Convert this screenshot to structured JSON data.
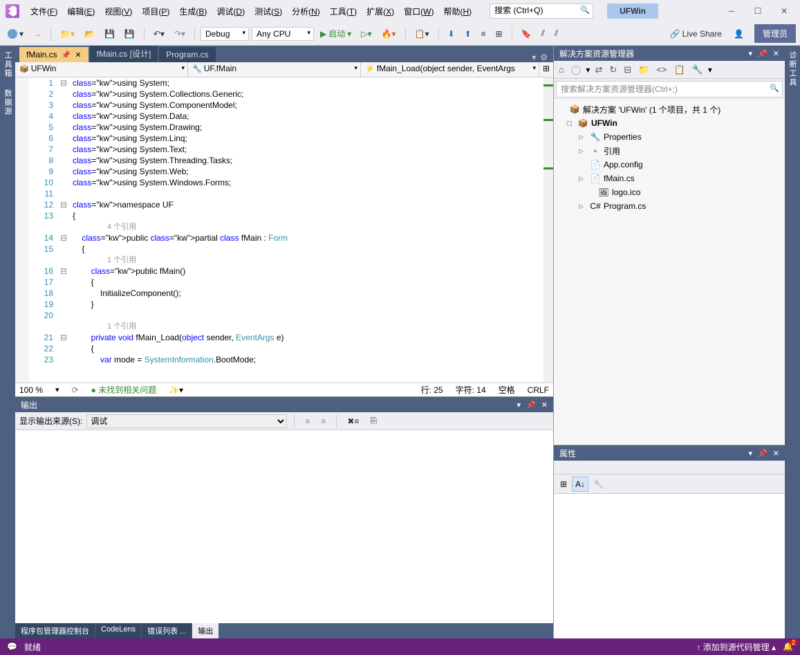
{
  "title_project": "UFWin",
  "search_placeholder": "搜索 (Ctrl+Q)",
  "admin_label": "管理员",
  "liveshare": "Live Share",
  "menu": [
    "文件(F)",
    "编辑(E)",
    "视图(V)",
    "项目(P)",
    "生成(B)",
    "调试(D)",
    "测试(S)",
    "分析(N)",
    "工具(T)",
    "扩展(X)",
    "窗口(W)",
    "帮助(H)"
  ],
  "toolbar_config": "Debug",
  "toolbar_platform": "Any CPU",
  "toolbar_run": "启动",
  "left_dock": [
    "工具箱",
    "数据源"
  ],
  "right_dock": "诊断工具",
  "editor_tabs": [
    {
      "label": "fMain.cs",
      "active": true
    },
    {
      "label": "fMain.cs [设计]",
      "active": false
    },
    {
      "label": "Program.cs",
      "active": false
    }
  ],
  "nav": {
    "scope": "UFWin",
    "class": "UF.fMain",
    "member": "fMain_Load(object sender, EventArgs"
  },
  "code_lines": [
    {
      "n": 1,
      "fold": "⊟",
      "t": "using System;"
    },
    {
      "n": 2,
      "t": "using System.Collections.Generic;"
    },
    {
      "n": 3,
      "t": "using System.ComponentModel;"
    },
    {
      "n": 4,
      "t": "using System.Data;"
    },
    {
      "n": 5,
      "t": "using System.Drawing;"
    },
    {
      "n": 6,
      "t": "using System.Linq;"
    },
    {
      "n": 7,
      "t": "using System.Text;"
    },
    {
      "n": 8,
      "t": "using System.Threading.Tasks;"
    },
    {
      "n": 9,
      "t": "using System.Web;"
    },
    {
      "n": 10,
      "t": "using System.Windows.Forms;"
    },
    {
      "n": 11,
      "t": ""
    },
    {
      "n": 12,
      "fold": "⊟",
      "t": "namespace UF"
    },
    {
      "n": 13,
      "t": "{"
    },
    {
      "ref": "4 个引用"
    },
    {
      "n": 14,
      "fold": "⊟",
      "t": "    public partial class fMain : Form"
    },
    {
      "n": 15,
      "t": "    {"
    },
    {
      "ref": "1 个引用"
    },
    {
      "n": 16,
      "fold": "⊟",
      "t": "        public fMain()"
    },
    {
      "n": 17,
      "t": "        {"
    },
    {
      "n": 18,
      "t": "            InitializeComponent();"
    },
    {
      "n": 19,
      "t": "        }"
    },
    {
      "n": 20,
      "t": ""
    },
    {
      "ref": "1 个引用"
    },
    {
      "n": 21,
      "fold": "⊟",
      "t": "        private void fMain_Load(object sender, EventArgs e)"
    },
    {
      "n": 22,
      "t": "        {"
    },
    {
      "n": 23,
      "t": "            var mode = SystemInformation.BootMode;"
    }
  ],
  "editor_status": {
    "zoom": "100 %",
    "issues": "未找到相关问题",
    "line": "行: 25",
    "col": "字符: 14",
    "insert": "空格",
    "eol": "CRLF"
  },
  "output": {
    "title": "输出",
    "source_label": "显示输出来源(S):",
    "source_value": "调试"
  },
  "bottom_tabs": [
    "程序包管理器控制台",
    "CodeLens",
    "错误列表 ...",
    "输出"
  ],
  "solution": {
    "title": "解决方案资源管理器",
    "search_placeholder": "搜索解决方案资源管理器(Ctrl+;)",
    "root": "解决方案 'UFWin' (1 个项目，共 1 个)",
    "project": "UFWin",
    "nodes": [
      {
        "icon": "🔧",
        "label": "Properties",
        "indent": 3,
        "ar": "▷"
      },
      {
        "icon": "▫",
        "label": "引用",
        "indent": 3,
        "ar": "▷"
      },
      {
        "icon": "📄",
        "label": "App.config",
        "indent": 3
      },
      {
        "icon": "📄",
        "label": "fMain.cs",
        "indent": 3,
        "ar": "▷"
      },
      {
        "icon": "🖼",
        "label": "logo.ico",
        "indent": 4
      },
      {
        "icon": "C#",
        "label": "Program.cs",
        "indent": 3,
        "ar": "▷"
      }
    ]
  },
  "properties_title": "属性",
  "status": {
    "ready": "就绪",
    "scm": "添加到源代码管理",
    "notif": "2"
  }
}
